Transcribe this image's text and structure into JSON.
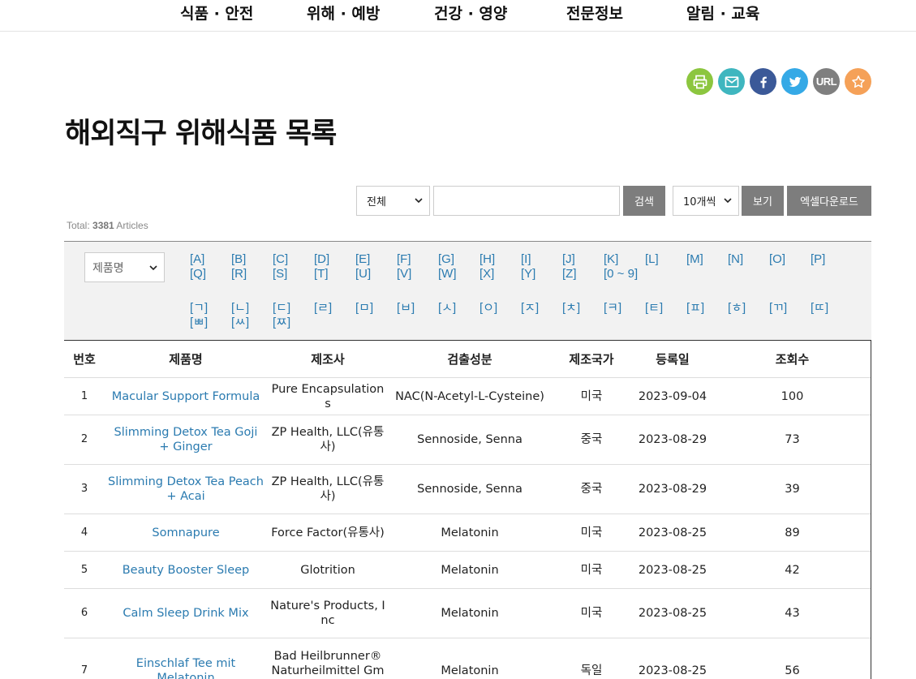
{
  "nav": [
    "식품 · 안전",
    "위해 · 예방",
    "건강 · 영양",
    "전문정보",
    "알림 · 교육"
  ],
  "share": {
    "icons": [
      "print-icon",
      "mail-icon",
      "facebook-icon",
      "twitter-icon",
      "url-icon",
      "star-icon"
    ],
    "url_label": "URL",
    "colors": {
      "print": "#8cc63f",
      "mail": "#3fb6bf",
      "facebook": "#3b5998",
      "twitter": "#35a9e6",
      "url": "#7f7f7f",
      "star": "#f5a158"
    }
  },
  "page_title": "해외직구 위해식품 목록",
  "search": {
    "category_value": "전체",
    "query_value": "",
    "search_label": "검색",
    "per_page_value": "10개씩",
    "view_label": "보기",
    "excel_label": "엑셀다운로드"
  },
  "total": {
    "prefix": "Total: ",
    "count": "3381",
    "suffix": " Articles"
  },
  "filter": {
    "field_value": "제품명",
    "latin": [
      "[A]",
      "[B]",
      "[C]",
      "[D]",
      "[E]",
      "[F]",
      "[G]",
      "[H]",
      "[I]",
      "[J]",
      "[K]",
      "[L]",
      "[M]",
      "[N]",
      "[O]",
      "[P]",
      "[Q]",
      "[R]",
      "[S]",
      "[T]",
      "[U]",
      "[V]",
      "[W]",
      "[X]",
      "[Y]",
      "[Z]",
      "[0 ~ 9]"
    ],
    "hangul": [
      "[ㄱ]",
      "[ㄴ]",
      "[ㄷ]",
      "[ㄹ]",
      "[ㅁ]",
      "[ㅂ]",
      "[ㅅ]",
      "[ㅇ]",
      "[ㅈ]",
      "[ㅊ]",
      "[ㅋ]",
      "[ㅌ]",
      "[ㅍ]",
      "[ㅎ]",
      "[ㄲ]",
      "[ㄸ]",
      "[ㅃ]",
      "[ㅆ]",
      "[ㅉ]"
    ]
  },
  "table": {
    "headers": [
      "번호",
      "제품명",
      "제조사",
      "검출성분",
      "제조국가",
      "등록일",
      "조회수"
    ],
    "rows": [
      [
        "1",
        "Macular Support Formula",
        "Pure Encapsulations",
        "NAC(N-Acetyl-L-Cysteine)",
        "미국",
        "2023-09-04",
        "100"
      ],
      [
        "2",
        "Slimming Detox Tea Goji + Ginger",
        "ZP Health, LLC(유통사)",
        "Sennoside, Senna",
        "중국",
        "2023-08-29",
        "73"
      ],
      [
        "3",
        "Slimming Detox Tea Peach + Acai",
        "ZP Health, LLC(유통사)",
        "Sennoside, Senna",
        "중국",
        "2023-08-29",
        "39"
      ],
      [
        "4",
        "Somnapure",
        "Force Factor(유통사)",
        "Melatonin",
        "미국",
        "2023-08-25",
        "89"
      ],
      [
        "5",
        "Beauty Booster Sleep",
        "Glotrition",
        "Melatonin",
        "미국",
        "2023-08-25",
        "42"
      ],
      [
        "6",
        "Calm Sleep Drink Mix",
        "Nature's Products, Inc",
        "Melatonin",
        "미국",
        "2023-08-25",
        "43"
      ],
      [
        "7",
        "Einschlaf Tee mit Melatonin",
        "Bad Heilbrunner® Naturheilmittel GmbH",
        "Melatonin",
        "독일",
        "2023-08-25",
        "56"
      ]
    ]
  }
}
